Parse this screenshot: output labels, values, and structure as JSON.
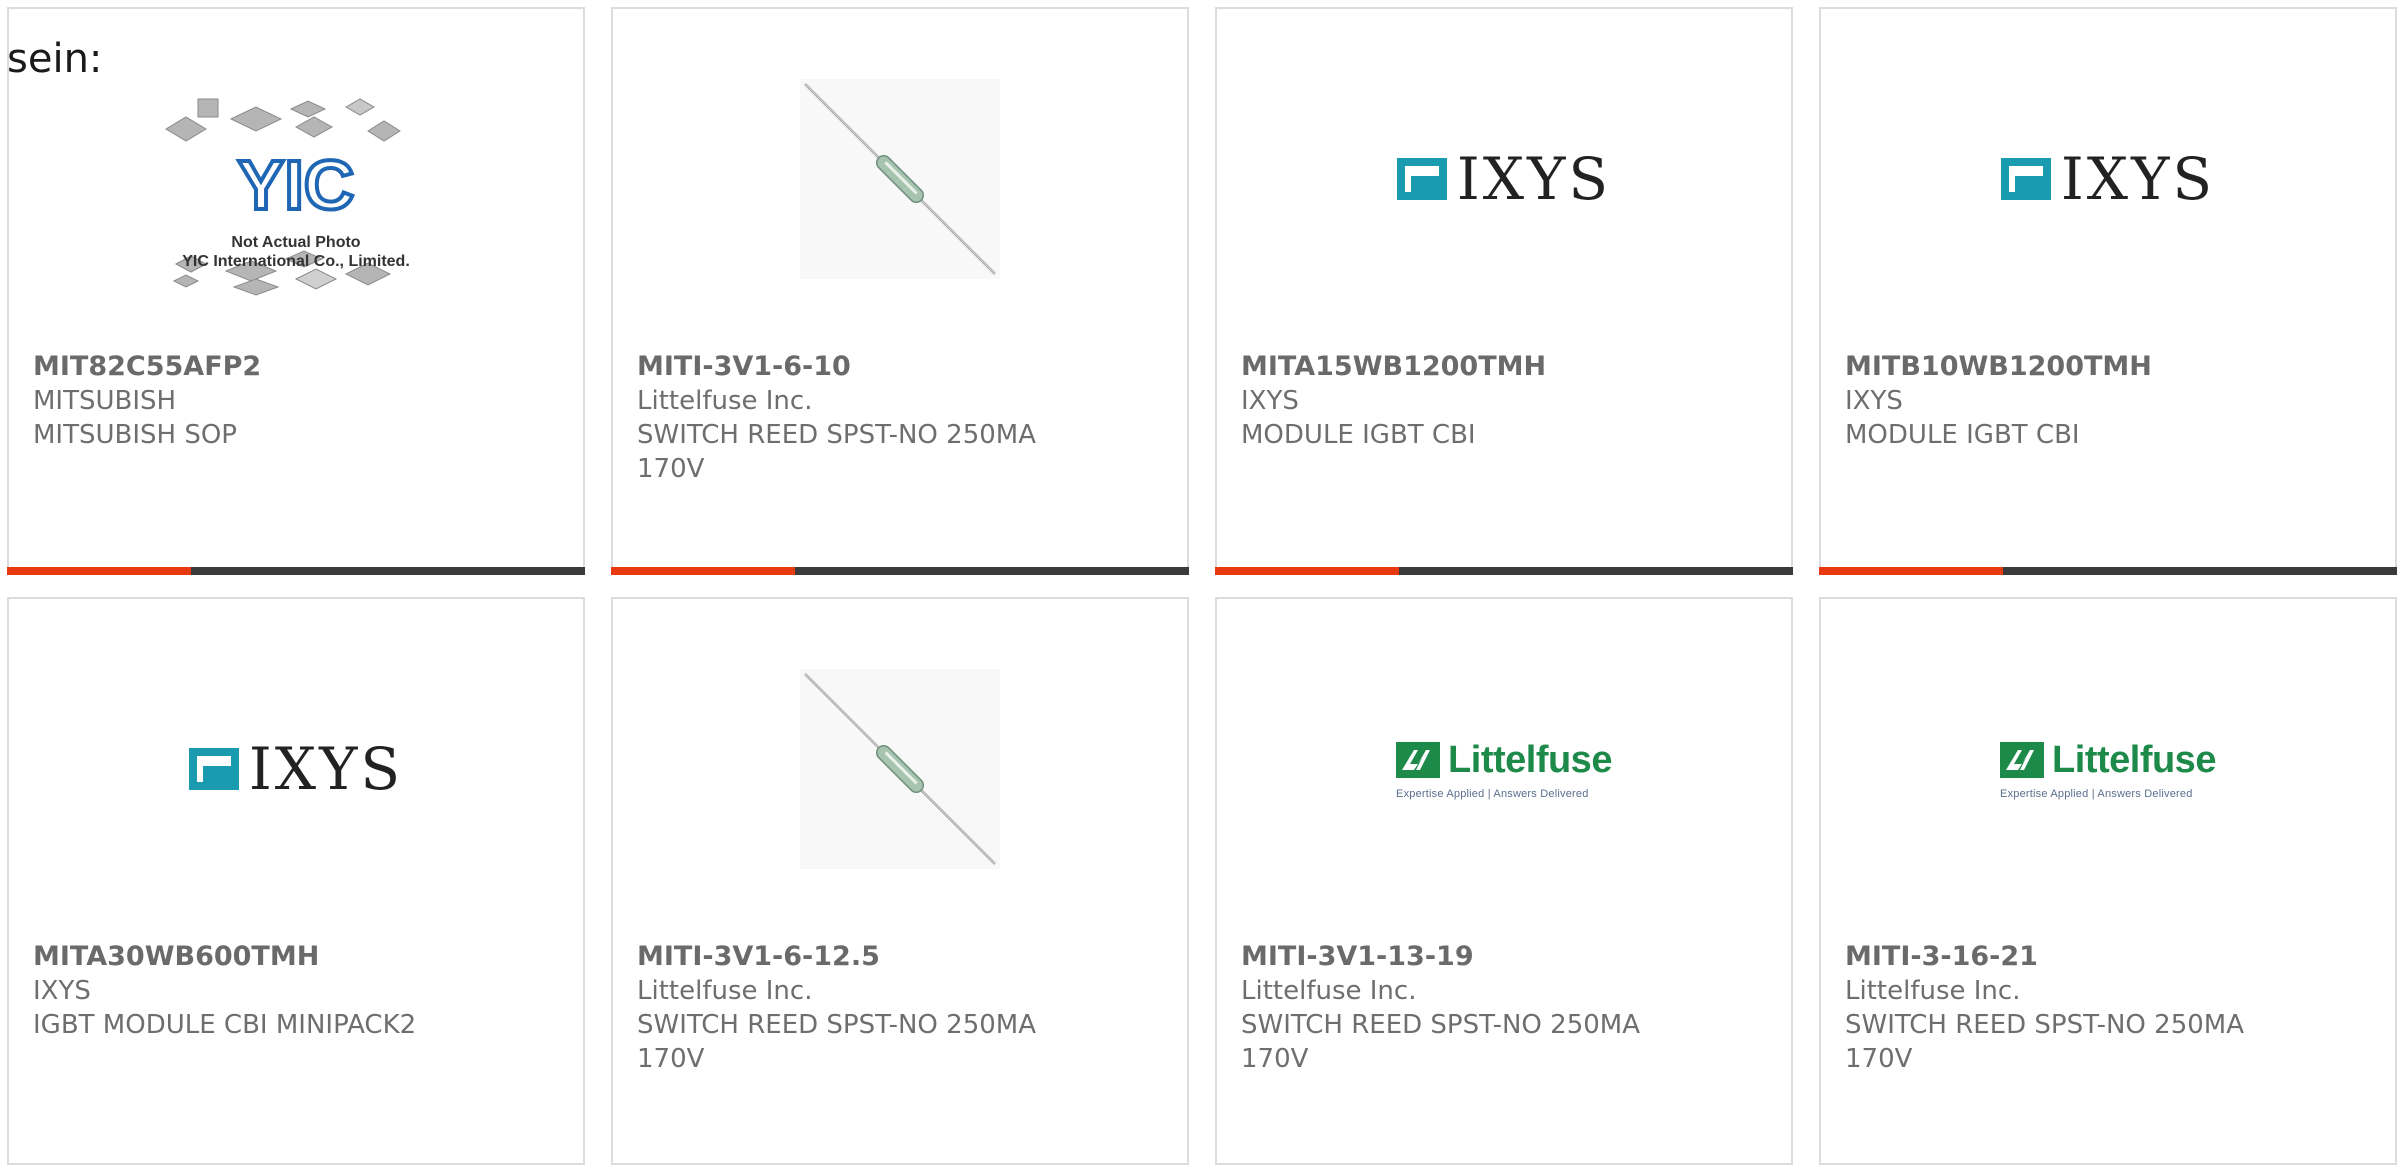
{
  "intro_text": "sein:",
  "placeholder_photo": {
    "brand": "YIC",
    "line1": "Not Actual Photo",
    "line2": "YIC International Co., Limited."
  },
  "logos": {
    "ixys": "IXYS",
    "littelfuse": "Littelfuse",
    "littelfuse_tagline": "Expertise Applied | Answers Delivered"
  },
  "colors": {
    "accent": "#e8380d",
    "bar": "#3a3a3a",
    "ixys_teal": "#1a9bb0",
    "littelfuse_green": "#1e8a4a"
  },
  "products": [
    {
      "part": "MIT82C55AFP2",
      "maker": "MITSUBISH",
      "desc": "MITSUBISH SOP",
      "image": "yic-placeholder"
    },
    {
      "part": "MITI-3V1-6-10",
      "maker": "Littelfuse Inc.",
      "desc": "SWITCH REED SPST-NO 250MA 170V",
      "image": "reed-switch"
    },
    {
      "part": "MITA15WB1200TMH",
      "maker": "IXYS",
      "desc": "MODULE IGBT CBI",
      "image": "ixys-logo"
    },
    {
      "part": "MITB10WB1200TMH",
      "maker": "IXYS",
      "desc": "MODULE IGBT CBI",
      "image": "ixys-logo"
    },
    {
      "part": "MITA30WB600TMH",
      "maker": "IXYS",
      "desc": "IGBT MODULE CBI MINIPACK2",
      "image": "ixys-logo"
    },
    {
      "part": "MITI-3V1-6-12.5",
      "maker": "Littelfuse Inc.",
      "desc": "SWITCH REED SPST-NO 250MA 170V",
      "image": "reed-switch"
    },
    {
      "part": "MITI-3V1-13-19",
      "maker": "Littelfuse Inc.",
      "desc": "SWITCH REED SPST-NO 250MA 170V",
      "image": "littelfuse-logo"
    },
    {
      "part": "MITI-3-16-21",
      "maker": "Littelfuse Inc.",
      "desc": "SWITCH REED SPST-NO 250MA 170V",
      "image": "littelfuse-logo"
    }
  ]
}
